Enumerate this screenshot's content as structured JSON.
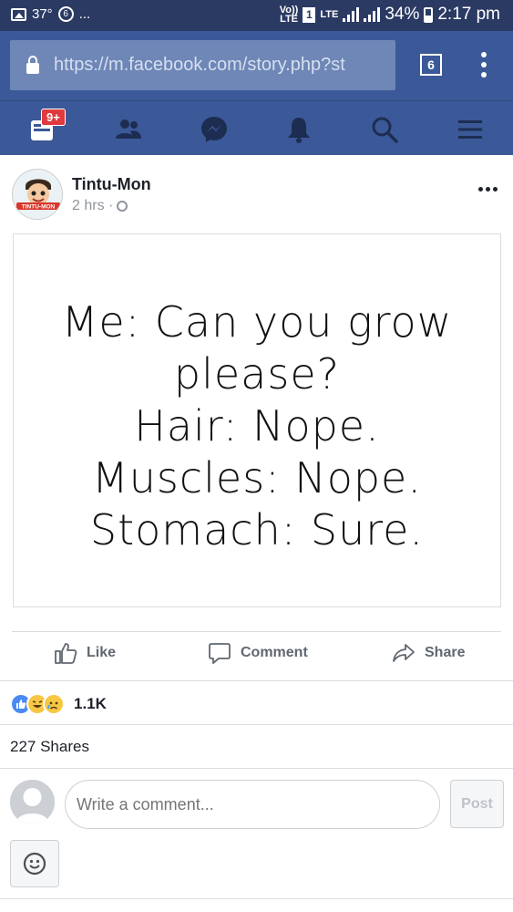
{
  "status_bar": {
    "temperature": "37°",
    "ellipsis": "...",
    "volte": "Vo)) LTE",
    "sim": "1",
    "lte": "LTE",
    "battery": "34%",
    "time": "2:17 pm"
  },
  "browser": {
    "url": "https://m.facebook.com/story.php?st",
    "tab_count": "6"
  },
  "nav": {
    "notification_badge": "9+",
    "items": [
      "feed",
      "friends",
      "messenger",
      "notifications",
      "search",
      "menu"
    ]
  },
  "post": {
    "author": "Tintu-Mon",
    "avatar_label": "TINTU-MON",
    "time": "2 hrs ·",
    "image_text": "Me: Can you grow\nplease?\nHair: Nope.\nMuscles: Nope.\nStomach: Sure."
  },
  "actions": {
    "like": "Like",
    "comment": "Comment",
    "share": "Share"
  },
  "reactions": {
    "count": "1.1K",
    "types": [
      "like",
      "haha",
      "sad"
    ]
  },
  "shares": "227 Shares",
  "comment_box": {
    "placeholder": "Write a comment...",
    "post_label": "Post"
  },
  "colors": {
    "brand": "#3b5998",
    "status_bar": "#2b3a63",
    "badge": "#e0393e"
  }
}
